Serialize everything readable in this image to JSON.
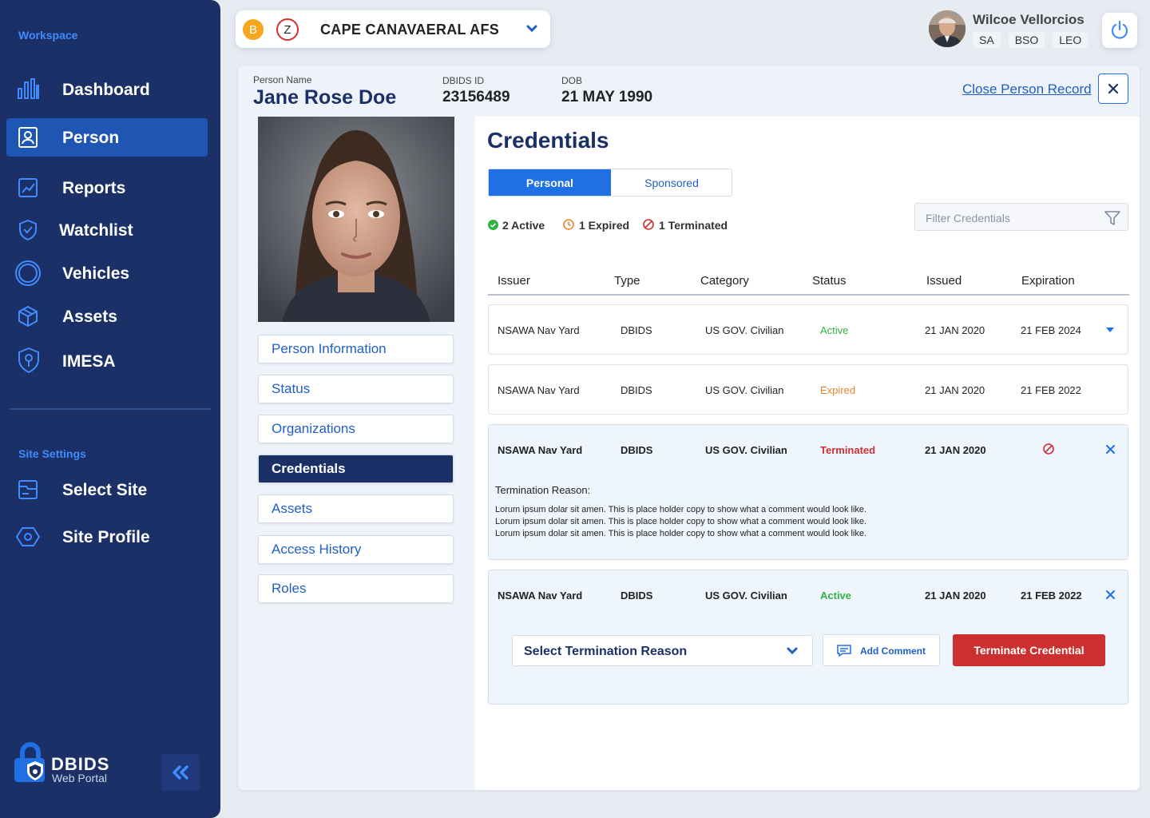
{
  "sidebar": {
    "workspace_label": "Workspace",
    "nav": [
      {
        "label": "Dashboard",
        "icon": "bar-chart-icon"
      },
      {
        "label": "Person",
        "icon": "person-card-icon",
        "active": true
      },
      {
        "label": "Reports",
        "icon": "trend-chart-icon"
      },
      {
        "label": "Watchlist",
        "icon": "shield-check-icon"
      },
      {
        "label": "Vehicles",
        "icon": "wheel-icon"
      },
      {
        "label": "Assets",
        "icon": "box-icon"
      },
      {
        "label": "IMESA",
        "icon": "shield-pin-icon"
      }
    ],
    "site_settings_label": "Site Settings",
    "site_nav": [
      {
        "label": "Select Site",
        "icon": "folder-icon"
      },
      {
        "label": "Site Profile",
        "icon": "hexagon-icon"
      }
    ],
    "logo_title": "DBIDS",
    "logo_subtitle": "Web Portal",
    "collapse_icon": "double-chevron-left-icon"
  },
  "site_selector": {
    "badge_b": "B",
    "badge_z": "Z",
    "name": "CAPE CANAVAERAL AFS"
  },
  "user": {
    "name": "Wilcoe Vellorcios",
    "roles": [
      "SA",
      "BSO",
      "LEO"
    ],
    "power_icon": "power-icon"
  },
  "person": {
    "name_label": "Person Name",
    "name": "Jane Rose Doe",
    "dbids_label": "DBIDS ID",
    "dbids_id": "23156489",
    "dob_label": "DOB",
    "dob": "21 MAY 1990",
    "close_link": "Close Person Record"
  },
  "person_menu": [
    "Person Information",
    "Status",
    "Organizations",
    "Credentials",
    "Assets",
    "Access History",
    "Roles"
  ],
  "credentials": {
    "title": "Credentials",
    "tabs": [
      "Personal",
      "Sponsored"
    ],
    "summary": {
      "active": "2 Active",
      "expired": "1 Expired",
      "terminated": "1 Terminated"
    },
    "filter_placeholder": "Filter Credentials",
    "columns": [
      "Issuer",
      "Type",
      "Category",
      "Status",
      "Issued",
      "Expiration"
    ],
    "rows": [
      {
        "issuer": "NSAWA Nav Yard",
        "type": "DBIDS",
        "category": "US GOV. Civilian",
        "status": "Active",
        "issued": "21 JAN 2020",
        "expiration": "21 FEB 2024"
      },
      {
        "issuer": "NSAWA Nav Yard",
        "type": "DBIDS",
        "category": "US GOV. Civilian",
        "status": "Expired",
        "issued": "21 JAN 2020",
        "expiration": "21 FEB 2022"
      },
      {
        "issuer": "NSAWA Nav Yard",
        "type": "DBIDS",
        "category": "US GOV. Civilian",
        "status": "Terminated",
        "issued": "21 JAN 2020",
        "expiration": ""
      },
      {
        "issuer": "NSAWA Nav Yard",
        "type": "DBIDS",
        "category": "US GOV. Civilian",
        "status": "Active",
        "issued": "21 JAN 2020",
        "expiration": "21 FEB 2022"
      }
    ],
    "termination_reason_label": "Termination Reason:",
    "termination_comment": [
      "Lorum ipsum dolar sit amen. This is place holder copy to show what a comment would look like.",
      "Lorum ipsum dolar sit amen. This is place holder copy to show what a comment would look like.",
      "Lorum ipsum dolar sit amen. This is place holder copy to show what a comment would look like."
    ],
    "select_reason_placeholder": "Select Termination Reason",
    "add_comment_label": "Add Comment",
    "terminate_button": "Terminate Credential"
  },
  "colors": {
    "sidebar": "#1b3066",
    "accent": "#1f6fe5",
    "active": "#2fb344",
    "expired": "#e8862a",
    "terminated": "#d0302f",
    "terminate_button": "#cc2f2f"
  }
}
